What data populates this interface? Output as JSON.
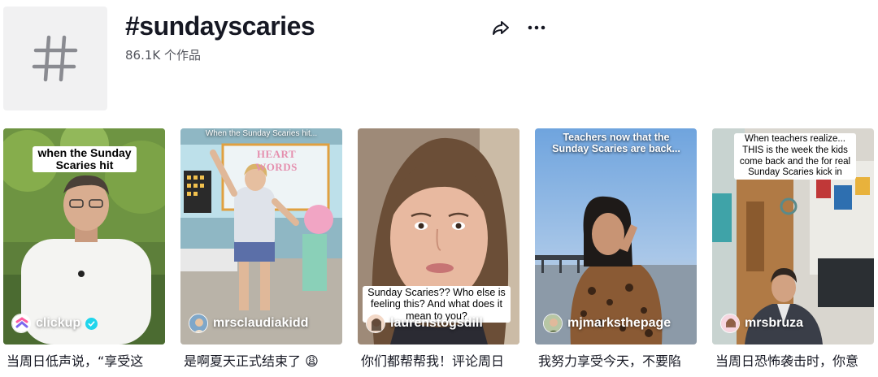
{
  "header": {
    "icon": "hashtag-icon",
    "title": "#sundayscaries",
    "post_count": "86.1K 个作品",
    "share_icon": "share-arrow-icon",
    "more_icon": "more-dots-icon"
  },
  "videos": [
    {
      "overlay_text": "when the Sunday Scaries hit",
      "author": "clickup",
      "verified": true,
      "description": "当周日低声说，“享受这"
    },
    {
      "overlay_text": "When the Sunday Scaries hit...",
      "scene_text": "HEART WORDS",
      "author": "mrsclaudiakidd",
      "verified": false,
      "description": "是啊夏天正式结束了 😩"
    },
    {
      "overlay_text": "Sunday Scaries?? Who else is feeling this? And what does it mean to you?",
      "author": "laurenstogsdill",
      "verified": false,
      "description": "你们都帮帮我！评论周日"
    },
    {
      "overlay_text": "Teachers now that the Sunday Scaries are back...",
      "author": "mjmarksthepage",
      "verified": false,
      "description": "我努力享受今天，不要陷"
    },
    {
      "overlay_text": "When teachers realize... THIS is the week the kids come back and the for real Sunday Scaries kick in",
      "author": "mrsbruza",
      "verified": false,
      "description": "当周日恐怖袭击时，你意"
    }
  ],
  "colors": {
    "verified_badge": "#20d5ec",
    "text_primary": "#161823",
    "tile_bg": "#f1f1f2"
  }
}
